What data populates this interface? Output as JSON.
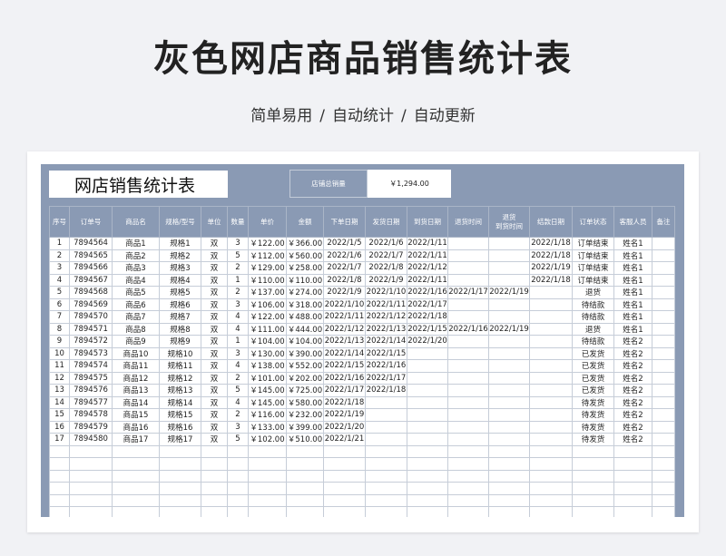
{
  "page": {
    "title": "灰色网店商品销售统计表",
    "subtitle_parts": [
      "简单易用",
      "自动统计",
      "自动更新"
    ],
    "separator": "/"
  },
  "sheet": {
    "title": "网店销售统计表",
    "total_label": "店铺总销量",
    "total_value": "￥1,294.00"
  },
  "table": {
    "headers": [
      "序号",
      "订单号",
      "商品名",
      "规格/型号",
      "单位",
      "数量",
      "单价",
      "金额",
      "下单日期",
      "发货日期",
      "到货日期",
      "退货时间",
      "退货\n到货时间",
      "结款日期",
      "订单状态",
      "客服人员",
      "备注"
    ],
    "rows": [
      [
        "1",
        "7894564",
        "商品1",
        "规格1",
        "双",
        "3",
        "￥122.00",
        "￥366.00",
        "2022/1/5",
        "2022/1/6",
        "2022/1/11",
        "",
        "",
        "2022/1/18",
        "订单结束",
        "姓名1",
        ""
      ],
      [
        "2",
        "7894565",
        "商品2",
        "规格2",
        "双",
        "5",
        "￥112.00",
        "￥560.00",
        "2022/1/6",
        "2022/1/7",
        "2022/1/11",
        "",
        "",
        "2022/1/18",
        "订单结束",
        "姓名1",
        ""
      ],
      [
        "3",
        "7894566",
        "商品3",
        "规格3",
        "双",
        "2",
        "￥129.00",
        "￥258.00",
        "2022/1/7",
        "2022/1/8",
        "2022/1/12",
        "",
        "",
        "2022/1/19",
        "订单结束",
        "姓名1",
        ""
      ],
      [
        "4",
        "7894567",
        "商品4",
        "规格4",
        "双",
        "1",
        "￥110.00",
        "￥110.00",
        "2022/1/8",
        "2022/1/9",
        "2022/1/11",
        "",
        "",
        "2022/1/18",
        "订单结束",
        "姓名1",
        ""
      ],
      [
        "5",
        "7894568",
        "商品5",
        "规格5",
        "双",
        "2",
        "￥137.00",
        "￥274.00",
        "2022/1/9",
        "2022/1/10",
        "2022/1/16",
        "2022/1/17",
        "2022/1/19",
        "",
        "退货",
        "姓名1",
        ""
      ],
      [
        "6",
        "7894569",
        "商品6",
        "规格6",
        "双",
        "3",
        "￥106.00",
        "￥318.00",
        "2022/1/10",
        "2022/1/11",
        "2022/1/17",
        "",
        "",
        "",
        "待结款",
        "姓名1",
        ""
      ],
      [
        "7",
        "7894570",
        "商品7",
        "规格7",
        "双",
        "4",
        "￥122.00",
        "￥488.00",
        "2022/1/11",
        "2022/1/12",
        "2022/1/18",
        "",
        "",
        "",
        "待结款",
        "姓名1",
        ""
      ],
      [
        "8",
        "7894571",
        "商品8",
        "规格8",
        "双",
        "4",
        "￥111.00",
        "￥444.00",
        "2022/1/12",
        "2022/1/13",
        "2022/1/15",
        "2022/1/16",
        "2022/1/19",
        "",
        "退货",
        "姓名1",
        ""
      ],
      [
        "9",
        "7894572",
        "商品9",
        "规格9",
        "双",
        "1",
        "￥104.00",
        "￥104.00",
        "2022/1/13",
        "2022/1/14",
        "2022/1/20",
        "",
        "",
        "",
        "待结款",
        "姓名2",
        ""
      ],
      [
        "10",
        "7894573",
        "商品10",
        "规格10",
        "双",
        "3",
        "￥130.00",
        "￥390.00",
        "2022/1/14",
        "2022/1/15",
        "",
        "",
        "",
        "",
        "已发货",
        "姓名2",
        ""
      ],
      [
        "11",
        "7894574",
        "商品11",
        "规格11",
        "双",
        "4",
        "￥138.00",
        "￥552.00",
        "2022/1/15",
        "2022/1/16",
        "",
        "",
        "",
        "",
        "已发货",
        "姓名2",
        ""
      ],
      [
        "12",
        "7894575",
        "商品12",
        "规格12",
        "双",
        "2",
        "￥101.00",
        "￥202.00",
        "2022/1/16",
        "2022/1/17",
        "",
        "",
        "",
        "",
        "已发货",
        "姓名2",
        ""
      ],
      [
        "13",
        "7894576",
        "商品13",
        "规格13",
        "双",
        "5",
        "￥145.00",
        "￥725.00",
        "2022/1/17",
        "2022/1/18",
        "",
        "",
        "",
        "",
        "已发货",
        "姓名2",
        ""
      ],
      [
        "14",
        "7894577",
        "商品14",
        "规格14",
        "双",
        "4",
        "￥145.00",
        "￥580.00",
        "2022/1/18",
        "",
        "",
        "",
        "",
        "",
        "待发货",
        "姓名2",
        ""
      ],
      [
        "15",
        "7894578",
        "商品15",
        "规格15",
        "双",
        "2",
        "￥116.00",
        "￥232.00",
        "2022/1/19",
        "",
        "",
        "",
        "",
        "",
        "待发货",
        "姓名2",
        ""
      ],
      [
        "16",
        "7894579",
        "商品16",
        "规格16",
        "双",
        "3",
        "￥133.00",
        "￥399.00",
        "2022/1/20",
        "",
        "",
        "",
        "",
        "",
        "待发货",
        "姓名2",
        ""
      ],
      [
        "17",
        "7894580",
        "商品17",
        "规格17",
        "双",
        "5",
        "￥102.00",
        "￥510.00",
        "2022/1/21",
        "",
        "",
        "",
        "",
        "",
        "待发货",
        "姓名2",
        ""
      ]
    ]
  },
  "colors": {
    "sheet_background": "#8a9ab4",
    "page_background": "#f1f2f5"
  }
}
